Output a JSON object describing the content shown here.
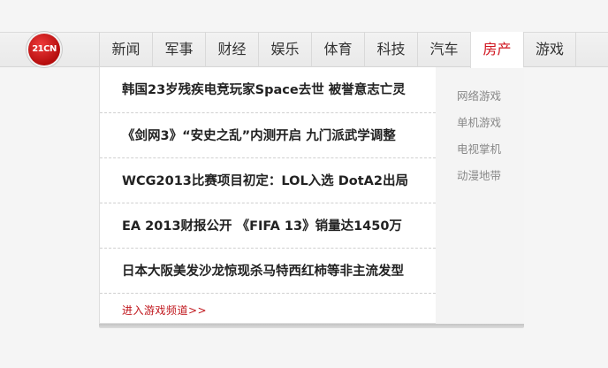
{
  "logo": {
    "text": "21CN"
  },
  "nav": {
    "items": [
      "新闻",
      "军事",
      "财经",
      "娱乐",
      "体育",
      "科技",
      "汽车",
      "房产",
      "游戏"
    ],
    "active_index": 7
  },
  "dropdown": {
    "headlines": [
      "韩国23岁残疾电竞玩家Space去世 被誉意志亡灵",
      "《剑网3》“安史之乱”内测开启 九门派武学调整",
      "WCG2013比赛项目初定：LOL入选 DotA2出局",
      "EA 2013财报公开 《FIFA 13》销量达1450万",
      "日本大阪美发沙龙惊现杀马特西红柿等非主流发型"
    ],
    "more_link": "进入游戏频道>>",
    "categories": [
      "网络游戏",
      "单机游戏",
      "电视掌机",
      "动漫地带"
    ]
  },
  "colors": {
    "accent": "#d0141e",
    "logo_red": "#c4161c",
    "nav_text": "#333333",
    "side_text": "#888888"
  }
}
